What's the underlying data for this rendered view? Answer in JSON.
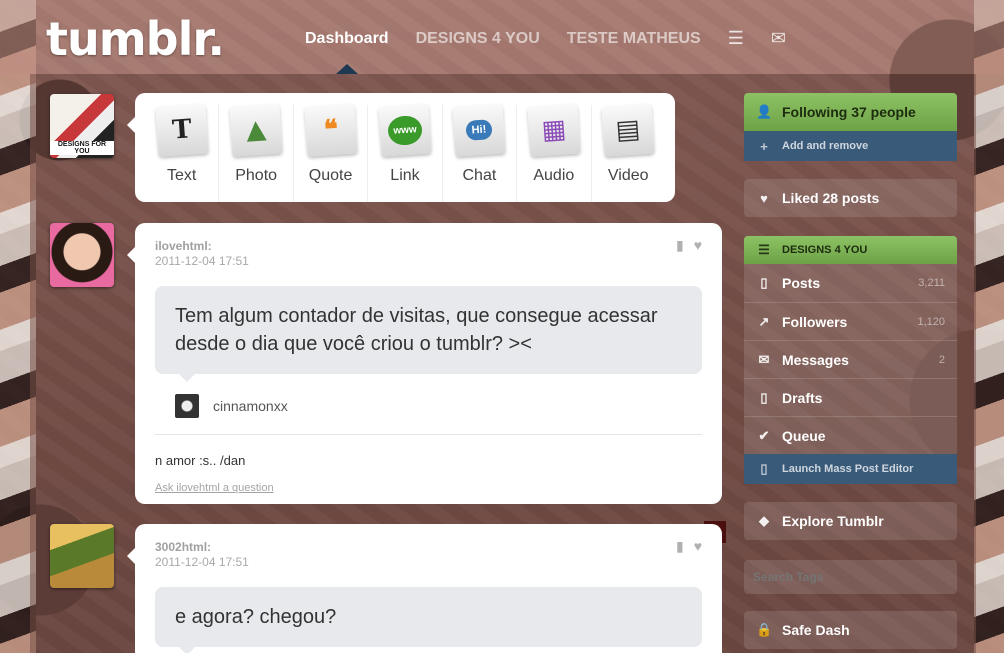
{
  "header": {
    "logo": "tumblr.",
    "nav": [
      {
        "label": "Dashboard",
        "active": true
      },
      {
        "label": "DESIGNS 4 YOU",
        "active": false
      },
      {
        "label": "TESTE MATHEUS",
        "active": false
      }
    ],
    "menu_icon": "list-icon",
    "mail_icon": "envelope-icon"
  },
  "post_types": [
    {
      "label": "Text",
      "icon": "text-icon",
      "glyph": "T",
      "color": "#222"
    },
    {
      "label": "Photo",
      "icon": "photo-icon",
      "glyph": "▲",
      "color": "#4a8a3a"
    },
    {
      "label": "Quote",
      "icon": "quote-icon",
      "glyph": "❝",
      "color": "#f08a20"
    },
    {
      "label": "Link",
      "icon": "link-icon",
      "glyph": "www",
      "color": "#3a9a2a"
    },
    {
      "label": "Chat",
      "icon": "chat-icon",
      "glyph": "Hi!",
      "color": "#3a7ab8"
    },
    {
      "label": "Audio",
      "icon": "audio-icon",
      "glyph": "▦",
      "color": "#8a4ab8"
    },
    {
      "label": "Video",
      "icon": "video-icon",
      "glyph": "▤",
      "color": "#333"
    }
  ],
  "avatars": {
    "blog_label": "DESIGNS FOR YOU"
  },
  "posts": [
    {
      "author": "ilovehtml:",
      "date": "2011-12-04 17:51",
      "question": "Tem algum contador de visitas, que consegue acessar desde o dia que você criou o tumblr? ><",
      "asker": "cinnamonxx",
      "answer": "n amor :s.. /dan",
      "ask_link": "Ask ilovehtml a question"
    },
    {
      "author": "3002html:",
      "date": "2011-12-04 17:51",
      "question": "e agora? chegou?"
    }
  ],
  "sidebar": {
    "following": "Following 37 people",
    "add_remove": "Add and remove",
    "liked": "Liked 28 posts",
    "blog_name": "DESIGNS 4 YOU",
    "blog_items": [
      {
        "label": "Posts",
        "count": "3,211",
        "icon": "document-icon",
        "glyph": "▯"
      },
      {
        "label": "Followers",
        "count": "1,120",
        "icon": "chart-icon",
        "glyph": "↗"
      },
      {
        "label": "Messages",
        "count": "2",
        "icon": "envelope-icon",
        "glyph": "✉"
      },
      {
        "label": "Drafts",
        "count": "",
        "icon": "draft-icon",
        "glyph": "▯"
      },
      {
        "label": "Queue",
        "count": "",
        "icon": "check-icon",
        "glyph": "✔"
      }
    ],
    "mass_editor": "Launch Mass Post Editor",
    "explore": "Explore Tumblr",
    "search_placeholder": "Search Tags",
    "safe_dash": "Safe Dash"
  }
}
